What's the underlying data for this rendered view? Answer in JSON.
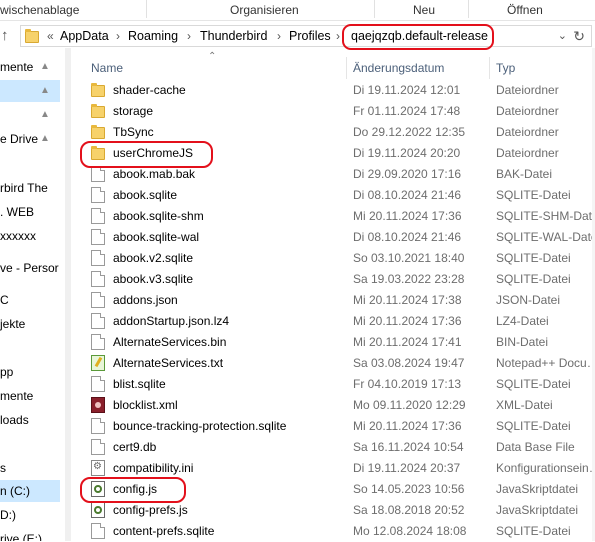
{
  "ribbon": {
    "groups": [
      "wischenablage",
      "Organisieren",
      "Neu",
      "Öffnen"
    ]
  },
  "address": {
    "overflow": "«",
    "crumbs": [
      "AppData",
      "Roaming",
      "Thunderbird",
      "Profiles",
      "qaejqzqb.default-release"
    ]
  },
  "nav": {
    "items": [
      "mente",
      "",
      "",
      "e Drive",
      "",
      "rbird The",
      ". WEB",
      "xxxxxx",
      "",
      "ve - Persor",
      "C",
      "jekte",
      "",
      "pp",
      "mente",
      "loads",
      "",
      "s",
      "n (C:)",
      "D:)",
      "rive (E:)"
    ]
  },
  "columns": {
    "name": "Name",
    "date": "Änderungsdatum",
    "type": "Typ"
  },
  "files": [
    {
      "name": "shader-cache",
      "date": "Di 19.11.2024 12:01",
      "type": "Dateiordner",
      "icon": "folder-icon"
    },
    {
      "name": "storage",
      "date": "Fr 01.11.2024 17:48",
      "type": "Dateiordner",
      "icon": "folder-icon"
    },
    {
      "name": "TbSync",
      "date": "Do 29.12.2022 12:35",
      "type": "Dateiordner",
      "icon": "folder-icon"
    },
    {
      "name": "userChromeJS",
      "date": "Di 19.11.2024 20:20",
      "type": "Dateiordner",
      "icon": "folder-icon"
    },
    {
      "name": "abook.mab.bak",
      "date": "Di 29.09.2020 17:16",
      "type": "BAK-Datei",
      "icon": "file-icon"
    },
    {
      "name": "abook.sqlite",
      "date": "Di 08.10.2024 21:46",
      "type": "SQLITE-Datei",
      "icon": "file-icon"
    },
    {
      "name": "abook.sqlite-shm",
      "date": "Mi 20.11.2024 17:36",
      "type": "SQLITE-SHM-Datei",
      "icon": "file-icon"
    },
    {
      "name": "abook.sqlite-wal",
      "date": "Di 08.10.2024 21:46",
      "type": "SQLITE-WAL-Datei",
      "icon": "file-icon"
    },
    {
      "name": "abook.v2.sqlite",
      "date": "So 03.10.2021 18:40",
      "type": "SQLITE-Datei",
      "icon": "file-icon"
    },
    {
      "name": "abook.v3.sqlite",
      "date": "Sa 19.03.2022 23:28",
      "type": "SQLITE-Datei",
      "icon": "file-icon"
    },
    {
      "name": "addons.json",
      "date": "Mi 20.11.2024 17:38",
      "type": "JSON-Datei",
      "icon": "file-icon"
    },
    {
      "name": "addonStartup.json.lz4",
      "date": "Mi 20.11.2024 17:36",
      "type": "LZ4-Datei",
      "icon": "file-icon"
    },
    {
      "name": "AlternateServices.bin",
      "date": "Mi 20.11.2024 17:41",
      "type": "BIN-Datei",
      "icon": "file-icon"
    },
    {
      "name": "AlternateServices.txt",
      "date": "Sa 03.08.2024 19:47",
      "type": "Notepad++ Docu…",
      "icon": "notepad-icon"
    },
    {
      "name": "blist.sqlite",
      "date": "Fr 04.10.2019 17:13",
      "type": "SQLITE-Datei",
      "icon": "file-icon"
    },
    {
      "name": "blocklist.xml",
      "date": "Mo 09.11.2020 12:29",
      "type": "XML-Datei",
      "icon": "xml-icon"
    },
    {
      "name": "bounce-tracking-protection.sqlite",
      "date": "Mi 20.11.2024 17:36",
      "type": "SQLITE-Datei",
      "icon": "file-icon"
    },
    {
      "name": "cert9.db",
      "date": "Sa 16.11.2024 10:54",
      "type": "Data Base File",
      "icon": "file-icon"
    },
    {
      "name": "compatibility.ini",
      "date": "Di 19.11.2024 20:37",
      "type": "Konfigurationsein…",
      "icon": "config-icon"
    },
    {
      "name": "config.js",
      "date": "So 14.05.2023 10:56",
      "type": "JavaSkriptdatei",
      "icon": "script-icon"
    },
    {
      "name": "config-prefs.js",
      "date": "Sa 18.08.2018 20:52",
      "type": "JavaSkriptdatei",
      "icon": "script-icon"
    },
    {
      "name": "content-prefs.sqlite",
      "date": "Mo 12.08.2024 18:08",
      "type": "SQLITE-Datei",
      "icon": "file-icon"
    }
  ],
  "colors": {
    "highlight": "#e3101b",
    "selection": "#cce8ff",
    "folder": "#f7d26b"
  }
}
